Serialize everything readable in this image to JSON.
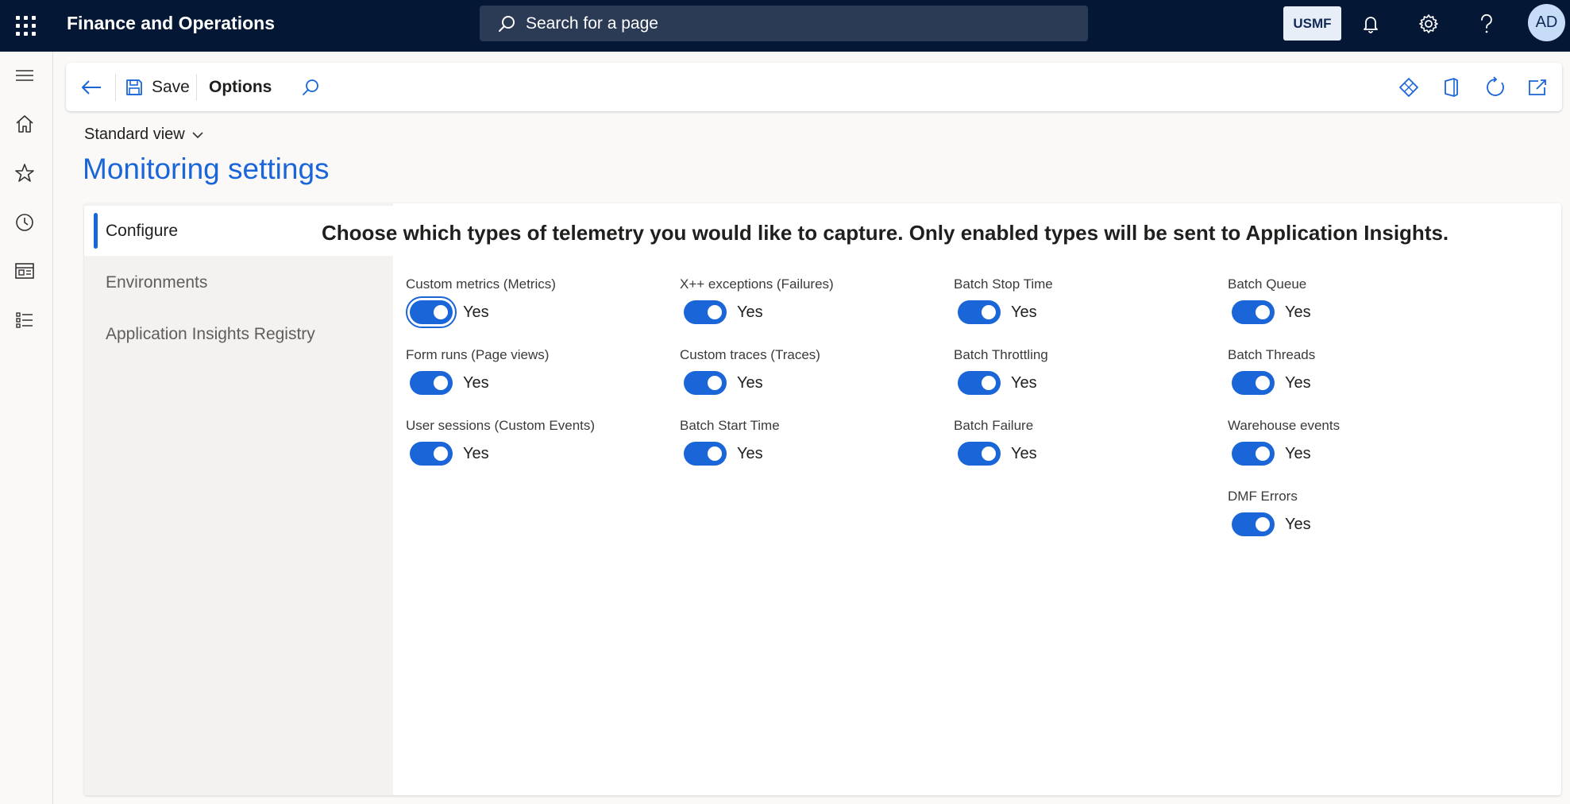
{
  "topbar": {
    "app_title": "Finance and Operations",
    "search_placeholder": "Search for a page",
    "company": "USMF",
    "user_initials": "AD"
  },
  "actionpane": {
    "save_label": "Save",
    "options_label": "Options"
  },
  "header": {
    "view_name": "Standard view",
    "page_title": "Monitoring settings"
  },
  "tabs": [
    {
      "label": "Configure",
      "active": true
    },
    {
      "label": "Environments",
      "active": false
    },
    {
      "label": "Application Insights Registry",
      "active": false
    }
  ],
  "configure": {
    "instruction": "Choose which types of telemetry you would like to capture. Only enabled types will be sent to Application Insights.",
    "fields": [
      {
        "label": "Custom metrics (Metrics)",
        "value": "Yes"
      },
      {
        "label": "Form runs (Page views)",
        "value": "Yes"
      },
      {
        "label": "User sessions (Custom Events)",
        "value": "Yes"
      },
      {
        "label": "X++ exceptions (Failures)",
        "value": "Yes"
      },
      {
        "label": "Custom traces (Traces)",
        "value": "Yes"
      },
      {
        "label": "Batch Start Time",
        "value": "Yes"
      },
      {
        "label": "Batch Stop Time",
        "value": "Yes"
      },
      {
        "label": "Batch Throttling",
        "value": "Yes"
      },
      {
        "label": "Batch Failure",
        "value": "Yes"
      },
      {
        "label": "Batch Queue",
        "value": "Yes"
      },
      {
        "label": "Batch Threads",
        "value": "Yes"
      },
      {
        "label": "Warehouse events",
        "value": "Yes"
      },
      {
        "label": "DMF Errors",
        "value": "Yes"
      }
    ]
  },
  "colors": {
    "accent": "#1a65d8",
    "topbar": "#041836"
  }
}
